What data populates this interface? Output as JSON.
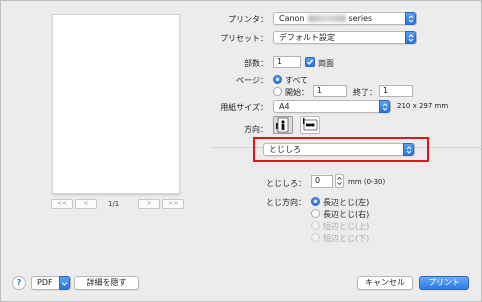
{
  "preview": {
    "page_indicator": "1/1",
    "nav": [
      "<<",
      "<",
      ">",
      ">>"
    ]
  },
  "printer": {
    "label": "プリンタ：",
    "brand": "Canon",
    "suffix": "series"
  },
  "preset": {
    "label": "プリセット：",
    "value": "デフォルト設定"
  },
  "copies": {
    "label": "部数：",
    "value": "1",
    "duplex_label": "両面"
  },
  "pages": {
    "label": "ページ：",
    "all": "すべて",
    "from_label": "開始：",
    "from_value": "1",
    "to_label": "終了：",
    "to_value": "1"
  },
  "paper_size": {
    "label": "用紙サイズ：",
    "value": "A4",
    "dims": "210 x 297 mm"
  },
  "orientation": {
    "label": "方向："
  },
  "section_menu": {
    "value": "とじしろ"
  },
  "margin": {
    "label": "とじしろ：",
    "value": "0",
    "unit": "mm (0-30)"
  },
  "binding": {
    "label": "とじ方向：",
    "options": [
      "長辺とじ(左)",
      "長辺とじ(右)",
      "短辺とじ(上)",
      "短辺とじ(下)"
    ]
  },
  "footer": {
    "help": "?",
    "pdf": "PDF",
    "hide_details": "詳細を隠す",
    "cancel": "キャンセル",
    "print": "プリント"
  },
  "colors": {
    "accent": "#2d74e0",
    "highlight": "#e0141a"
  }
}
